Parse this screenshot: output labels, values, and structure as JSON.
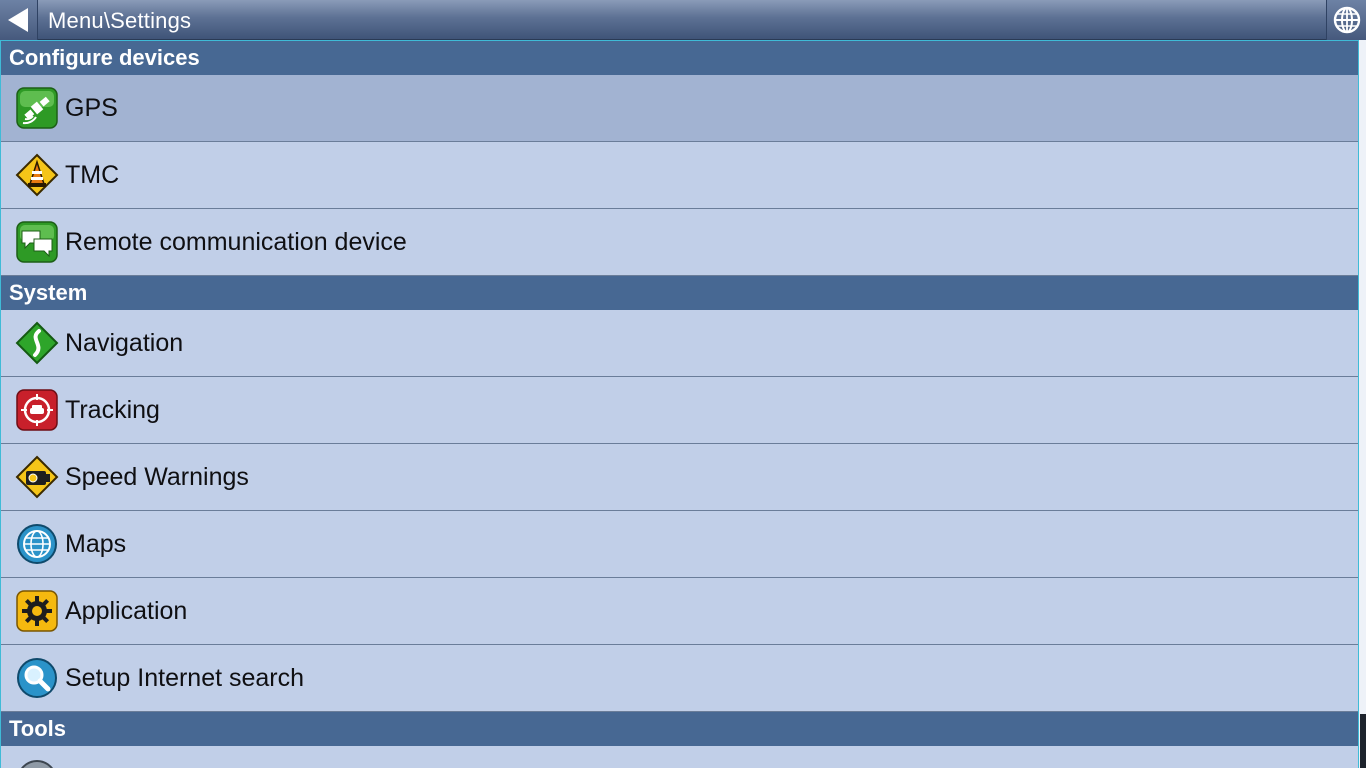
{
  "header": {
    "title": "Menu\\Settings",
    "back_icon": "back-arrow-icon",
    "globe_icon": "globe-icon"
  },
  "sections": [
    {
      "title": "Configure devices",
      "items": [
        {
          "label": "GPS",
          "icon": "gps-satellite-icon",
          "selected": true
        },
        {
          "label": "TMC",
          "icon": "tmc-traffic-cone-icon"
        },
        {
          "label": "Remote communication device",
          "icon": "chat-bubbles-icon"
        }
      ]
    },
    {
      "title": "System",
      "items": [
        {
          "label": "Navigation",
          "icon": "road-sign-icon"
        },
        {
          "label": "Tracking",
          "icon": "car-target-icon"
        },
        {
          "label": "Speed Warnings",
          "icon": "speed-camera-icon"
        },
        {
          "label": "Maps",
          "icon": "globe-icon"
        },
        {
          "label": "Application",
          "icon": "gear-icon"
        },
        {
          "label": "Setup Internet search",
          "icon": "magnifier-icon"
        }
      ]
    },
    {
      "title": "Tools",
      "items": []
    }
  ],
  "colors": {
    "section_bg": "#476893",
    "item_bg": "#c1cfe8",
    "item_selected_bg": "#a2b3d2",
    "accent_border": "#3fbbd7"
  }
}
